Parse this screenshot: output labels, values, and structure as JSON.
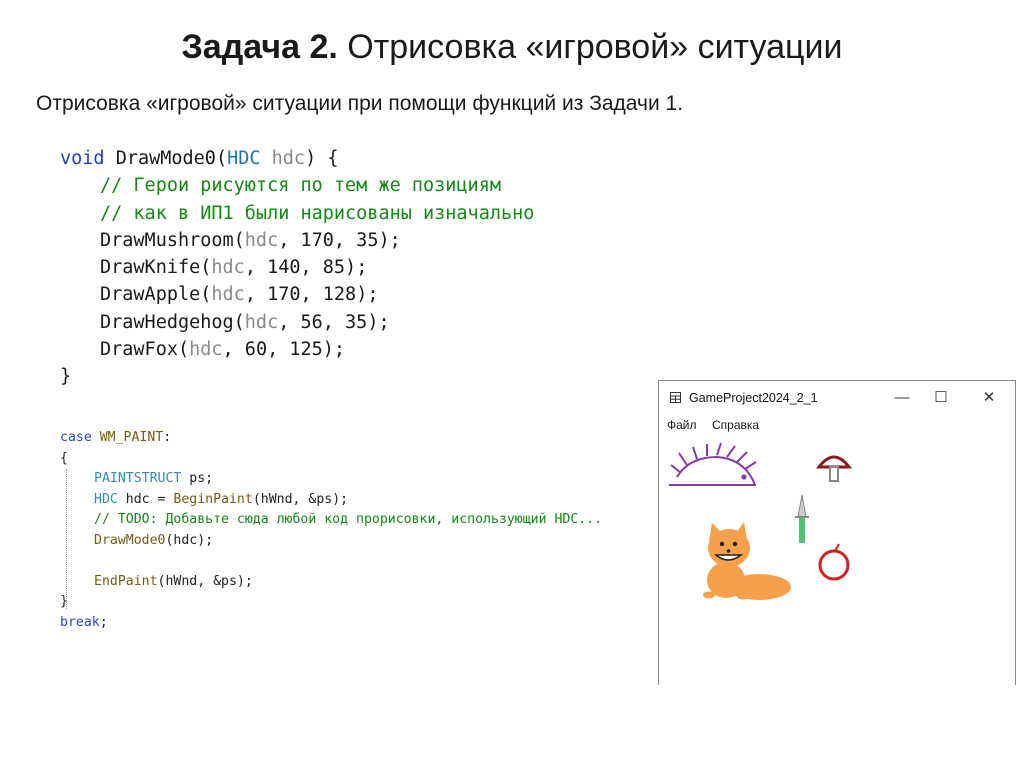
{
  "slide": {
    "title_bold": "Задача 2.",
    "title_rest": " Отрисовка «игровой» ситуации",
    "subtitle": "Отрисовка «игровой» ситуации при помощи функций из Задачи 1."
  },
  "code_main": {
    "l1_kw": "void",
    "l1_fn": " DrawMode0(",
    "l1_ty": "HDC",
    "l1_par": " hdc",
    "l1_end": ") {",
    "c1": "// Герои рисуются по тем же позициям",
    "c2": "// как в ИП1 были нарисованы изначально",
    "calls": [
      {
        "fn": "DrawMushroom(",
        "arg": "hdc",
        "rest": ", 170, 35);"
      },
      {
        "fn": "DrawKnife(",
        "arg": "hdc",
        "rest": ", 140, 85);"
      },
      {
        "fn": "DrawApple(",
        "arg": "hdc",
        "rest": ", 170, 128);"
      },
      {
        "fn": "DrawHedgehog(",
        "arg": "hdc",
        "rest": ", 56, 35);"
      },
      {
        "fn": "DrawFox(",
        "arg": "hdc",
        "rest": ", 60, 125);"
      }
    ],
    "close": "}"
  },
  "code_case": {
    "case_kw": "case",
    "case_const": " WM_PAINT",
    "case_colon": ":",
    "open": "{",
    "p1_ty": "PAINTSTRUCT",
    "p1_rest": " ps;",
    "p2_ty": "HDC",
    "p2_var": " hdc = ",
    "p2_fn": "BeginPaint",
    "p2_rest": "(hWnd, &ps);",
    "p3_cm": "// TODO: Добавьте сюда любой код прорисовки, использующий HDC...",
    "p4_fn": "DrawMode0",
    "p4_rest": "(hdc);",
    "p5_fn": "EndPaint",
    "p5_rest": "(hWnd, &ps);",
    "close": "}",
    "brk_kw": "break",
    "brk_end": ";"
  },
  "window": {
    "title": "GameProject2024_2_1",
    "minimize": "—",
    "maximize": "☐",
    "close": "✕",
    "menu_file": "Файл",
    "menu_help": "Справка"
  },
  "colors": {
    "keyword": "#1e3fc8",
    "type": "#1e78b0",
    "comment": "#138a13",
    "fox": "#f5a04a",
    "hedgehog": "#8a3aa8",
    "mushroom": "#8b1a1a",
    "apple": "#d21f1f",
    "knife": "#4fc46a"
  },
  "icons": [
    "window-app-icon",
    "minimize-icon",
    "maximize-icon",
    "close-icon"
  ]
}
